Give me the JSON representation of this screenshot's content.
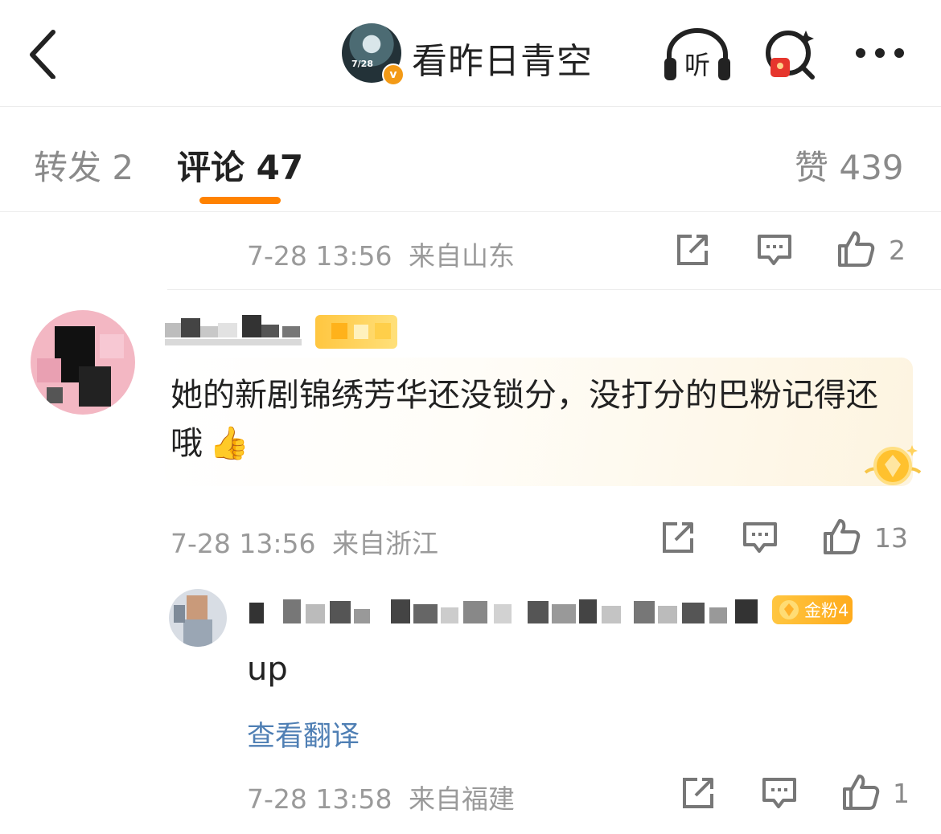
{
  "header": {
    "title": "看昨日青空",
    "avatar_date": "7/28",
    "verified_mark": "v",
    "listen_label": "听"
  },
  "tabs": {
    "repost": "转发 2",
    "comments": "评论 47",
    "likes": "赞 439"
  },
  "top_item": {
    "time": "7-28 13:56",
    "location": "来自山东",
    "like_count": "2"
  },
  "comment": {
    "text": "她的新剧锦绣芳华还没锁分，没打分的巴粉记得还哦",
    "emoji": "👍",
    "time": "7-28 13:56",
    "location": "来自浙江",
    "like_count": "13"
  },
  "reply": {
    "badge": "金粉4",
    "text": "up",
    "translate": "查看翻译",
    "time": "7-28 13:58",
    "location": "来自福建",
    "like_count": "1"
  },
  "colors": {
    "accent": "#ff8200",
    "link": "#4f7fb4",
    "gold_badge": "#ffb92e"
  },
  "icons": [
    "back-icon",
    "listen-icon",
    "search-redpacket-icon",
    "more-icon",
    "share-icon",
    "comment-icon",
    "like-icon",
    "medal-icon"
  ]
}
